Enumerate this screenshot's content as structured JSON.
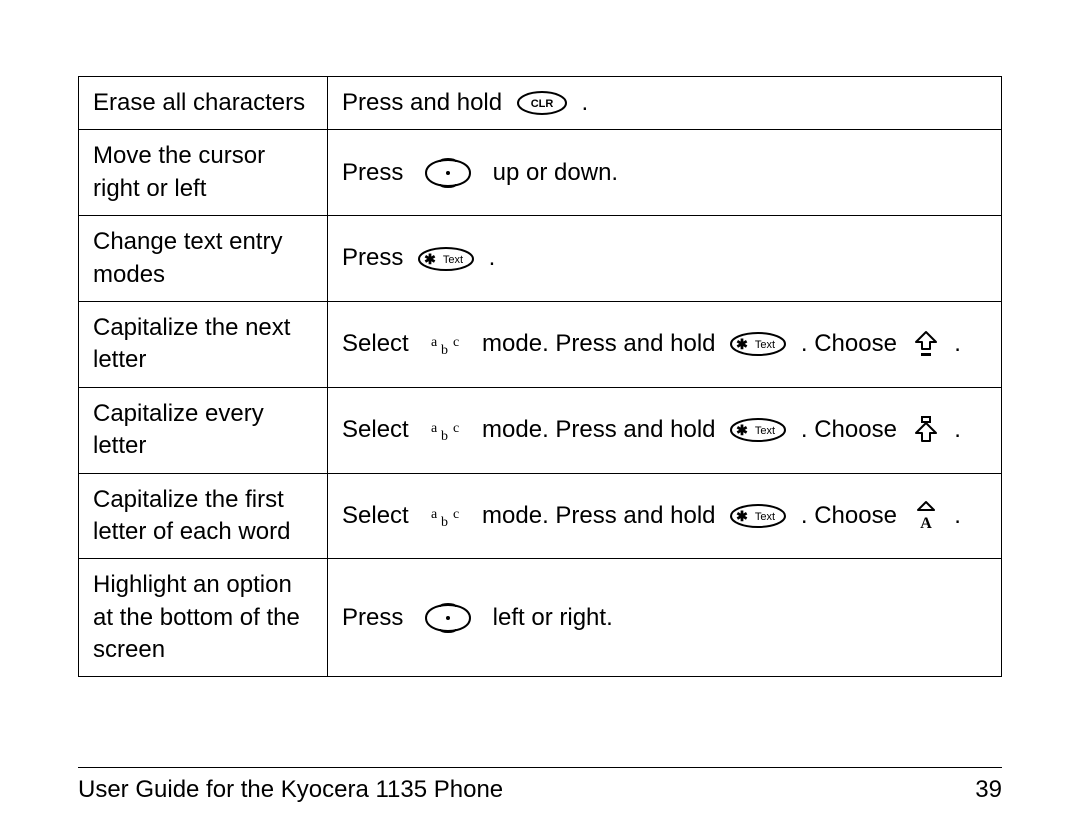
{
  "rows": [
    {
      "label": "Erase all characters",
      "parts": [
        {
          "t": "text",
          "v": "Press and hold "
        },
        {
          "t": "icon",
          "v": "clr-key-icon"
        },
        {
          "t": "text",
          "v": " ."
        }
      ]
    },
    {
      "label": "Move the cursor right or left",
      "parts": [
        {
          "t": "text",
          "v": "Press "
        },
        {
          "t": "icon",
          "v": "nav-key-icon"
        },
        {
          "t": "text",
          "v": " up or down."
        }
      ]
    },
    {
      "label": "Change text entry modes",
      "parts": [
        {
          "t": "text",
          "v": "Press "
        },
        {
          "t": "icon",
          "v": "text-key-icon"
        },
        {
          "t": "text",
          "v": " ."
        }
      ]
    },
    {
      "label": "Capitalize the next letter",
      "parts": [
        {
          "t": "text",
          "v": "Select "
        },
        {
          "t": "icon",
          "v": "abc-mode-icon"
        },
        {
          "t": "text",
          "v": " mode. Press and hold "
        },
        {
          "t": "icon",
          "v": "text-key-icon"
        },
        {
          "t": "text",
          "v": " . Choose "
        },
        {
          "t": "icon",
          "v": "shift-once-icon"
        },
        {
          "t": "text",
          "v": " ."
        }
      ]
    },
    {
      "label": "Capitalize every letter",
      "parts": [
        {
          "t": "text",
          "v": "Select "
        },
        {
          "t": "icon",
          "v": "abc-mode-icon"
        },
        {
          "t": "text",
          "v": " mode. Press and hold "
        },
        {
          "t": "icon",
          "v": "text-key-icon"
        },
        {
          "t": "text",
          "v": " . Choose "
        },
        {
          "t": "icon",
          "v": "shift-lock-icon"
        },
        {
          "t": "text",
          "v": " ."
        }
      ]
    },
    {
      "label": "Capitalize the first letter of each word",
      "parts": [
        {
          "t": "text",
          "v": "Select "
        },
        {
          "t": "icon",
          "v": "abc-mode-icon"
        },
        {
          "t": "text",
          "v": " mode. Press and hold "
        },
        {
          "t": "icon",
          "v": "text-key-icon"
        },
        {
          "t": "text",
          "v": " . Choose "
        },
        {
          "t": "icon",
          "v": "shift-word-icon"
        },
        {
          "t": "text",
          "v": " ."
        }
      ]
    },
    {
      "label": "Highlight an option at the bottom of the screen",
      "parts": [
        {
          "t": "text",
          "v": "Press "
        },
        {
          "t": "icon",
          "v": "nav-key-icon"
        },
        {
          "t": "text",
          "v": " left or right."
        }
      ]
    }
  ],
  "footer": {
    "title": "User Guide for the Kyocera 1135 Phone",
    "page": "39"
  }
}
